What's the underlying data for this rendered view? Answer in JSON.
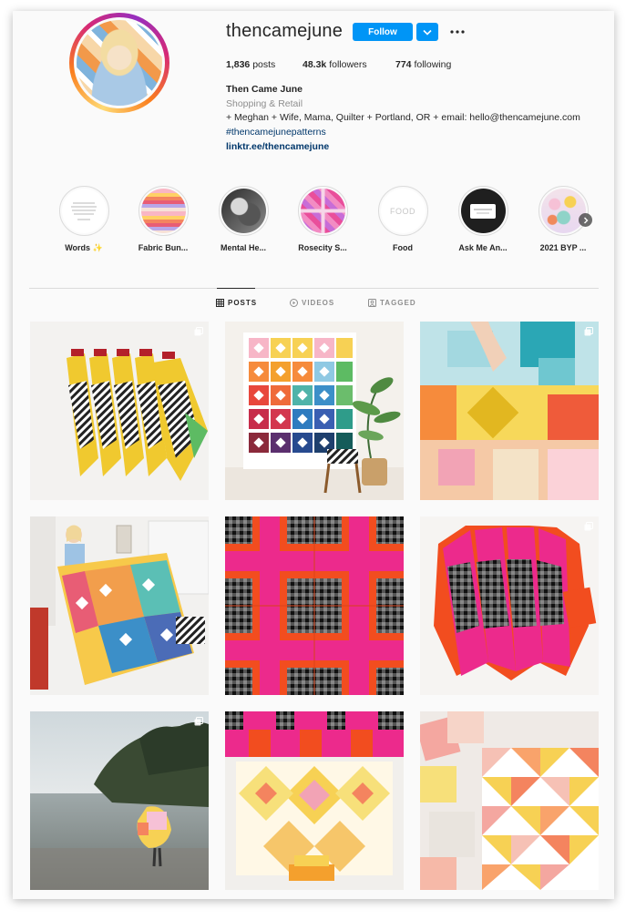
{
  "profile": {
    "username": "thencamejune",
    "follow_label": "Follow",
    "stats": {
      "posts_count": "1,836",
      "posts_label": "posts",
      "followers_count": "48.3k",
      "followers_label": "followers",
      "following_count": "774",
      "following_label": "following"
    },
    "bio": {
      "name": "Then Came June",
      "category": "Shopping & Retail",
      "text": "+ Meghan + Wife, Mama, Quilter + Portland, OR + email: hello@thencamejune.com",
      "hashtag": "#thencamejunepatterns",
      "link": "linktr.ee/thencamejune"
    }
  },
  "highlights": [
    {
      "label": "Words ✨",
      "icon": "text-card"
    },
    {
      "label": "Fabric Bun...",
      "icon": "fabric-stack"
    },
    {
      "label": "Mental He...",
      "icon": "bw-photo"
    },
    {
      "label": "Rosecity S...",
      "icon": "pink-quilt"
    },
    {
      "label": "Food",
      "icon": "food-text",
      "inner_text": "FOOD"
    },
    {
      "label": "Ask Me An...",
      "icon": "question-card"
    },
    {
      "label": "2021 BYP ...",
      "icon": "colorful-circles"
    }
  ],
  "tabs": [
    {
      "label": "POSTS",
      "icon": "grid-icon",
      "active": true
    },
    {
      "label": "VIDEOS",
      "icon": "video-icon",
      "active": false
    },
    {
      "label": "TAGGED",
      "icon": "tag-icon",
      "active": false
    }
  ],
  "posts": [
    {
      "subject": "folded quilts with black-white stripes and yellow/green",
      "multi": true
    },
    {
      "subject": "rainbow quilt on wall with plant and chair",
      "multi": false
    },
    {
      "subject": "colorful quilt close-up held by hand",
      "multi": true
    },
    {
      "subject": "woman holding rainbow quilt indoors",
      "multi": false
    },
    {
      "subject": "pink and orange gingham quilt blocks",
      "multi": false
    },
    {
      "subject": "folded pink and gingham quilts",
      "multi": true
    },
    {
      "subject": "quilt on beach with rocky coast",
      "multi": true
    },
    {
      "subject": "yellow diamond quilt hanging on wall",
      "multi": false
    },
    {
      "subject": "peach and yellow triangle quilt blocks",
      "multi": false
    }
  ],
  "colors": {
    "accent": "#0095f6",
    "link": "#00376b",
    "muted": "#8e8e8e",
    "text": "#262626",
    "border": "#dbdbdb"
  }
}
